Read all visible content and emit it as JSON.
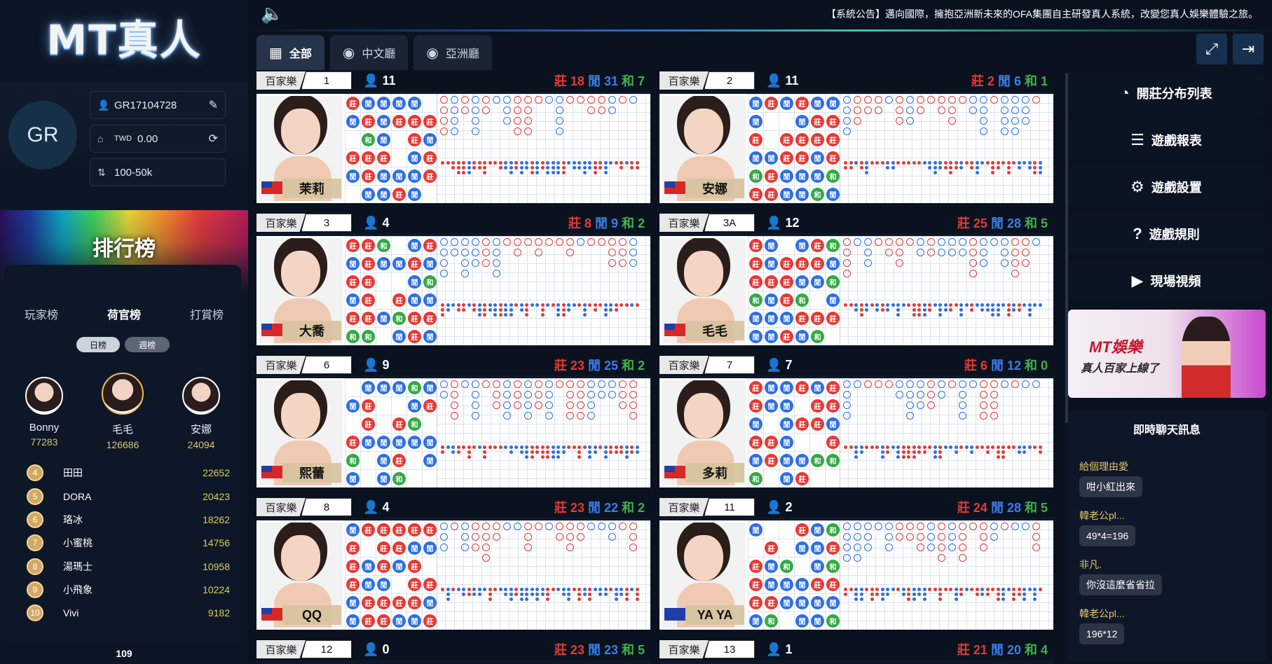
{
  "brand": {
    "logo": "MT真人"
  },
  "user": {
    "initials": "GR",
    "account": "GR17104728",
    "currency": "TWD",
    "balance": "0.00",
    "limit": "100-50k"
  },
  "ranking": {
    "title": "排行榜",
    "tabs": [
      "玩家榜",
      "荷官榜",
      "打賞榜"
    ],
    "periods": [
      "日榜",
      "週榜"
    ],
    "top3": [
      {
        "rank": "2",
        "name": "Bonny",
        "score": "77283"
      },
      {
        "rank": "1",
        "name": "毛毛",
        "score": "126686"
      },
      {
        "rank": "3",
        "name": "安娜",
        "score": "24094"
      }
    ],
    "list": [
      {
        "rank": "4",
        "name": "田田",
        "score": "22652"
      },
      {
        "rank": "5",
        "name": "DORA",
        "score": "20423"
      },
      {
        "rank": "6",
        "name": "珞冰",
        "score": "18262"
      },
      {
        "rank": "7",
        "name": "小蜜桃",
        "score": "14756"
      },
      {
        "rank": "8",
        "name": "湯瑪士",
        "score": "10958"
      },
      {
        "rank": "9",
        "name": "小飛象",
        "score": "10224"
      },
      {
        "rank": "10",
        "name": "Vivi",
        "score": "9182"
      }
    ],
    "online": "109"
  },
  "announcement": "【系統公告】邁向國際，擁抱亞洲新未來的OFA集團自主研發真人系統，改變您真人娛樂體驗之旅。",
  "tabs": [
    {
      "label": "全部",
      "icon": "grid-icon"
    },
    {
      "label": "中文廳",
      "icon": "chip-icon"
    },
    {
      "label": "亞洲廳",
      "icon": "chip-icon"
    }
  ],
  "tables": [
    {
      "game": "百家樂",
      "no": "1",
      "players": "11",
      "banker": "莊 18",
      "player": "閒 31",
      "tie": "和 7",
      "dealer": "茉莉"
    },
    {
      "game": "百家樂",
      "no": "2",
      "players": "11",
      "banker": "莊 2",
      "player": "閒 6",
      "tie": "和 1",
      "dealer": "安娜"
    },
    {
      "game": "百家樂",
      "no": "3",
      "players": "4",
      "banker": "莊 8",
      "player": "閒 9",
      "tie": "和 2",
      "dealer": "大喬"
    },
    {
      "game": "百家樂",
      "no": "3A",
      "players": "12",
      "banker": "莊 25",
      "player": "閒 28",
      "tie": "和 5",
      "dealer": "毛毛"
    },
    {
      "game": "百家樂",
      "no": "6",
      "players": "9",
      "banker": "莊 23",
      "player": "閒 25",
      "tie": "和 2",
      "dealer": "熙蕾"
    },
    {
      "game": "百家樂",
      "no": "7",
      "players": "7",
      "banker": "莊 6",
      "player": "閒 12",
      "tie": "和 0",
      "dealer": "多莉"
    },
    {
      "game": "百家樂",
      "no": "8",
      "players": "4",
      "banker": "莊 23",
      "player": "閒 22",
      "tie": "和 2",
      "dealer": "QQ"
    },
    {
      "game": "百家樂",
      "no": "11",
      "players": "2",
      "banker": "莊 24",
      "player": "閒 28",
      "tie": "和 5",
      "dealer": "YA YA"
    },
    {
      "game": "百家樂",
      "no": "12",
      "players": "0",
      "banker": "莊 23",
      "player": "閒 23",
      "tie": "和 5",
      "dealer": ""
    },
    {
      "game": "百家樂",
      "no": "13",
      "players": "1",
      "banker": "莊 21",
      "player": "閒 20",
      "tie": "和 4",
      "dealer": ""
    }
  ],
  "side_buttons": [
    {
      "label": "開莊分布列表",
      "icon": "clock-icon"
    },
    {
      "label": "遊戲報表",
      "icon": "report-icon"
    },
    {
      "label": "遊戲設置",
      "icon": "gear-icon"
    },
    {
      "label": "遊戲規則",
      "icon": "help-icon"
    },
    {
      "label": "現場視頻",
      "icon": "camera-icon"
    }
  ],
  "banner": {
    "line1": "MT娛樂",
    "line2": "真人百家上線了"
  },
  "chat": {
    "title": "即時聊天訊息",
    "messages": [
      {
        "user": "給個理由愛",
        "text": "咁小紅出來"
      },
      {
        "user": "韓老公pl...",
        "text": "49*4=196"
      },
      {
        "user": "非凡.",
        "text": "你沒這麼省省拉"
      },
      {
        "user": "韓老公pl...",
        "text": "196*12"
      }
    ]
  },
  "colors": {
    "banker": "#e53935",
    "player": "#2f6fe0",
    "tie": "#35a845"
  }
}
